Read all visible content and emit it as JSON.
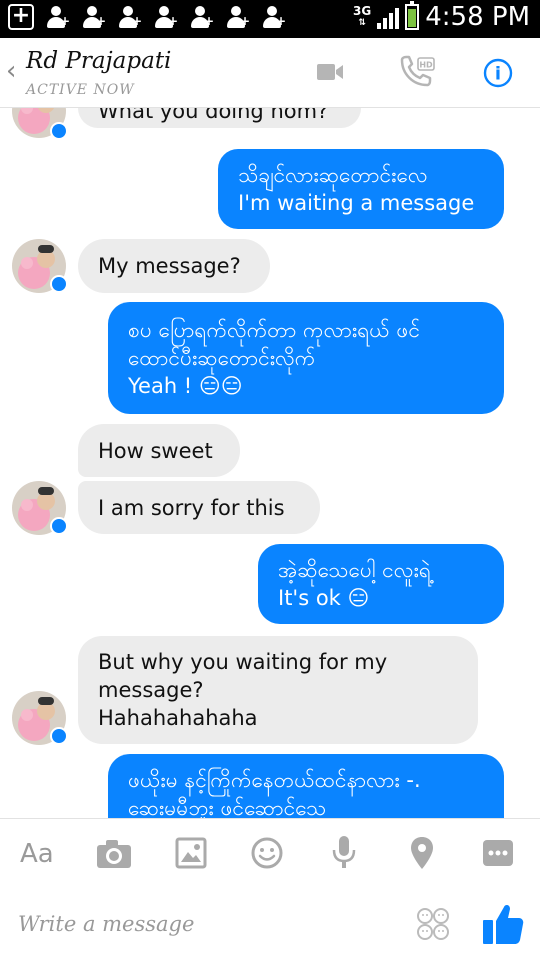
{
  "status_bar": {
    "network": "3G",
    "time": "4:58 PM"
  },
  "header": {
    "back_glyph": "‹",
    "contact_name": "Rd Prajapati",
    "status": "ACTIVE NOW",
    "video_icon": "video-camera-icon",
    "call_icon": "phone-hd-icon",
    "info_icon": "info-icon",
    "call_badge": "HD",
    "info_glyph": "i",
    "accent_color": "#0a84ff"
  },
  "messages": [
    {
      "side": "in",
      "text": "What you doing hom?"
    },
    {
      "side": "out",
      "lines": [
        "သိချင်လားဆုတောင်းလေ",
        "I'm waiting a message"
      ]
    },
    {
      "side": "in",
      "text": "My message?"
    },
    {
      "side": "out",
      "lines": [
        "စပ ပြောရက်လိုက်တာ ကုလားရယ် ဖင်",
        "ထောင်ပီးဆုတောင်းလိုက်",
        "Yeah ! 😑😑"
      ]
    },
    {
      "side": "in",
      "text": "How sweet"
    },
    {
      "side": "in",
      "text": "I am sorry for this"
    },
    {
      "side": "out",
      "lines": [
        "အဲ့ဆိုသေပေါ့ ငလူးရဲ့",
        "It's ok 😑"
      ]
    },
    {
      "side": "in",
      "lines": [
        "But why you waiting for my",
        "message?",
        "Hahahahahaha"
      ]
    },
    {
      "side": "out",
      "lines": [
        "ဖယိုးမ နင့်ကြိုက်နေတယ်ထင်နာလား -.",
        "ဆေးမမီဘူး ဖင်ဆောင်သေ"
      ]
    }
  ],
  "toolbar": {
    "text_label": "Aa",
    "items": [
      "camera-icon",
      "gallery-icon",
      "sticker-icon",
      "microphone-icon",
      "location-icon",
      "more-icon"
    ]
  },
  "composer": {
    "placeholder": "Write a message",
    "stickers_icon": "emoji-sticker-icon",
    "like_icon": "thumbs-up-icon"
  }
}
